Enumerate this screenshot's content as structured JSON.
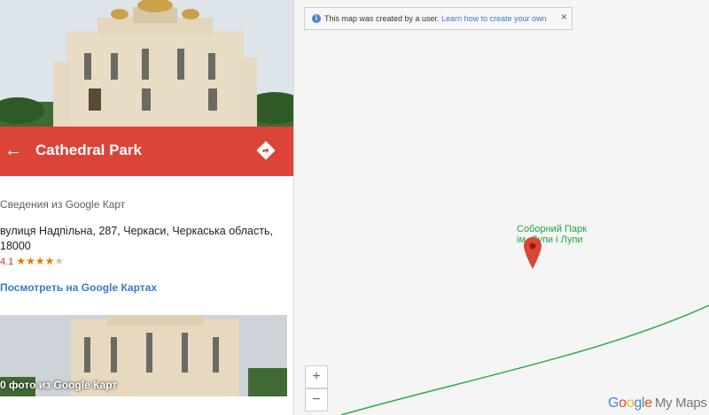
{
  "place": {
    "title": "Cathedral Park",
    "source": "Сведения из Google Карт",
    "address": "вулиця Надпільна, 287, Черкаси, Черкаська область, 18000",
    "rating": "4.1",
    "stars": "★★★★",
    "star_empty": "★",
    "gmaps_link": "Посмотреть на Google Картах",
    "photos_label": "0 фото из Google Карт",
    "back_icon": "arrow-left-icon",
    "directions_icon": "directions-icon",
    "header_color": "#db4437"
  },
  "notice": {
    "text": "This map was created by a user.",
    "link": "Learn how to create your own",
    "close": "×"
  },
  "map": {
    "label_line1": "Соборний Парк",
    "label_line2": "ім. Лупи і Лупи",
    "zoom_in": "+",
    "zoom_out": "−",
    "pin_color": "#db4437",
    "route_color": "#34a853"
  },
  "brand": {
    "google": [
      "G",
      "o",
      "o",
      "g",
      "l",
      "e"
    ],
    "suffix": "My Maps"
  }
}
